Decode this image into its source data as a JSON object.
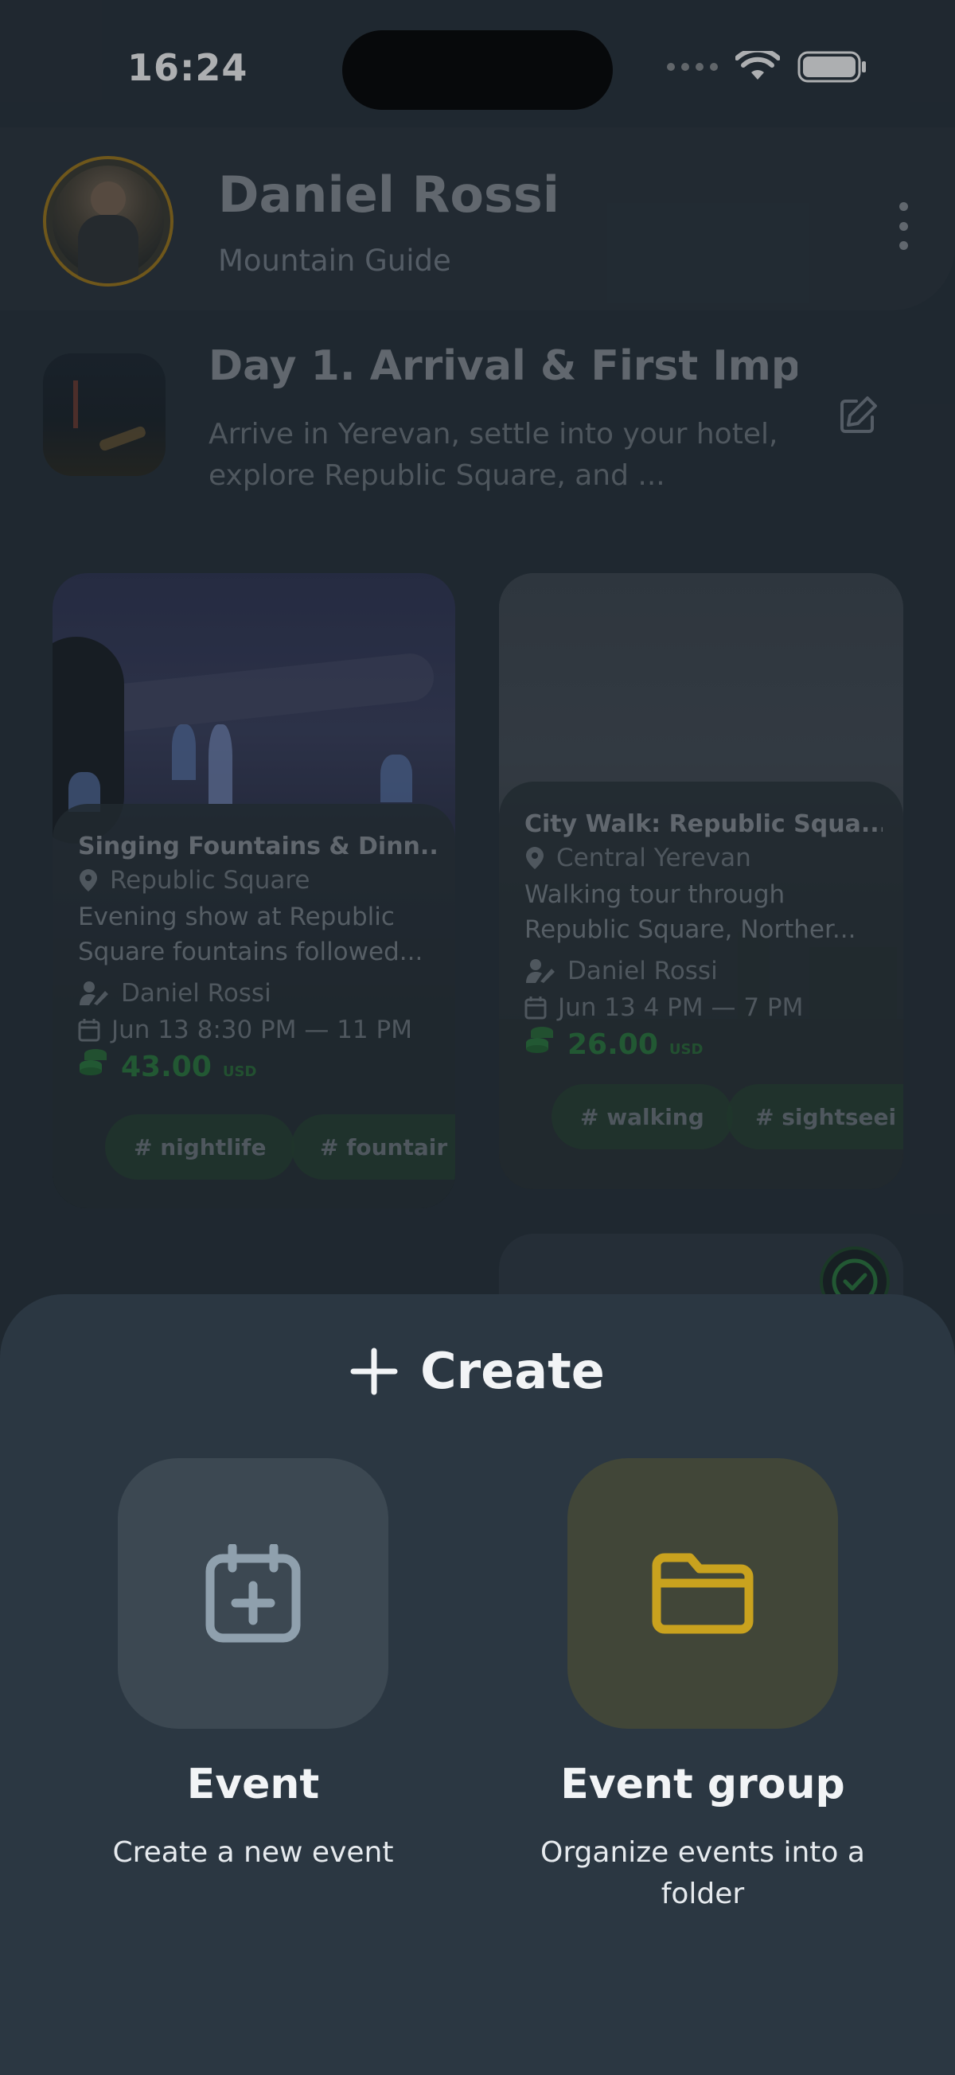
{
  "status_bar": {
    "time": "16:24"
  },
  "profile": {
    "name": "Daniel Rossi",
    "role": "Mountain Guide"
  },
  "day": {
    "title": "Day 1. Arrival & First Imp...",
    "description": "Arrive in Yerevan, settle into your hotel, explore Republic Square, and ..."
  },
  "cards": [
    {
      "title": "Singing Fountains & Dinn...",
      "location": "Republic Square",
      "description": "Evening show at Republic Square fountains followed...",
      "host": "Daniel Rossi",
      "datetime": "Jun 13 8:30 PM — 11 PM",
      "price": "43.00",
      "currency": "USD",
      "tags": [
        "# nightlife",
        "# fountair"
      ]
    },
    {
      "title": "City Walk: Republic Squa...",
      "location": "Central Yerevan",
      "description": "Walking tour through Republic Square, Norther...",
      "host": "Daniel Rossi",
      "datetime": "Jun 13 4 PM — 7 PM",
      "price": "26.00",
      "currency": "USD",
      "tags": [
        "# walking",
        "# sightseei"
      ]
    }
  ],
  "sheet": {
    "title": "Create",
    "options": [
      {
        "label": "Event",
        "subtitle": "Create a new event",
        "icon": "calendar-plus-icon",
        "color": "#8fa0ad"
      },
      {
        "label": "Event group",
        "subtitle": "Organize events into a folder",
        "icon": "folder-icon",
        "color": "#c9a21e"
      }
    ]
  },
  "colors": {
    "accent_gold": "#a0781a",
    "price_green": "#2a7a3e",
    "sheet_bg": "#2b3742"
  }
}
